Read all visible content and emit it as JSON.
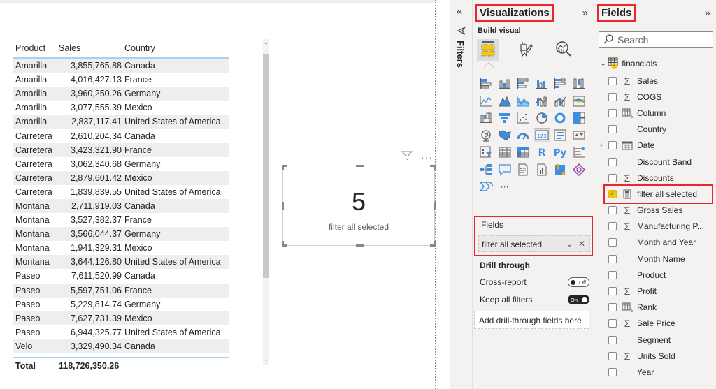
{
  "table": {
    "columns": [
      "Product",
      "Sales",
      "Country"
    ],
    "rows": [
      [
        "Amarilla",
        "3,855,765.88",
        "Canada"
      ],
      [
        "Amarilla",
        "4,016,427.13",
        "France"
      ],
      [
        "Amarilla",
        "3,960,250.26",
        "Germany"
      ],
      [
        "Amarilla",
        "3,077,555.39",
        "Mexico"
      ],
      [
        "Amarilla",
        "2,837,117.41",
        "United States of America"
      ],
      [
        "Carretera",
        "2,610,204.34",
        "Canada"
      ],
      [
        "Carretera",
        "3,423,321.90",
        "France"
      ],
      [
        "Carretera",
        "3,062,340.68",
        "Germany"
      ],
      [
        "Carretera",
        "2,879,601.42",
        "Mexico"
      ],
      [
        "Carretera",
        "1,839,839.55",
        "United States of America"
      ],
      [
        "Montana",
        "2,711,919.03",
        "Canada"
      ],
      [
        "Montana",
        "3,527,382.37",
        "France"
      ],
      [
        "Montana",
        "3,566,044.37",
        "Germany"
      ],
      [
        "Montana",
        "1,941,329.31",
        "Mexico"
      ],
      [
        "Montana",
        "3,644,126.80",
        "United States of America"
      ],
      [
        "Paseo",
        "7,611,520.99",
        "Canada"
      ],
      [
        "Paseo",
        "5,597,751.06",
        "France"
      ],
      [
        "Paseo",
        "5,229,814.74",
        "Germany"
      ],
      [
        "Paseo",
        "7,627,731.39",
        "Mexico"
      ],
      [
        "Paseo",
        "6,944,325.77",
        "United States of America"
      ],
      [
        "Velo",
        "3,329,490.34",
        "Canada"
      ]
    ],
    "total_label": "Total",
    "total_value": "118,726,350.26"
  },
  "card": {
    "value": "5",
    "label": "filter all selected"
  },
  "filters_pane": {
    "label": "Filters"
  },
  "visualizations": {
    "title": "Visualizations",
    "build_visual": "Build visual",
    "more_label": "···",
    "fields_well": {
      "title": "Fields",
      "value": "filter all selected"
    },
    "drill_through": {
      "title": "Drill through",
      "cross_report": {
        "label": "Cross-report",
        "state": "Off"
      },
      "keep_all_filters": {
        "label": "Keep all filters",
        "state": "On"
      },
      "dropzone": "Add drill-through fields here"
    }
  },
  "fields": {
    "title": "Fields",
    "search_placeholder": "Search",
    "table_name": "financials",
    "items": [
      {
        "label": "Sales",
        "icon": "sigma",
        "checked": false
      },
      {
        "label": "COGS",
        "icon": "sigma",
        "checked": false
      },
      {
        "label": "Column",
        "icon": "calc-table",
        "checked": false
      },
      {
        "label": "Country",
        "icon": "",
        "checked": false
      },
      {
        "label": "Date",
        "icon": "calendar",
        "checked": false,
        "expandable": true
      },
      {
        "label": "Discount Band",
        "icon": "",
        "checked": false
      },
      {
        "label": "Discounts",
        "icon": "sigma",
        "checked": false
      },
      {
        "label": "filter all selected",
        "icon": "calculator",
        "checked": true
      },
      {
        "label": "Gross Sales",
        "icon": "sigma",
        "checked": false
      },
      {
        "label": "Manufacturing P...",
        "icon": "sigma",
        "checked": false
      },
      {
        "label": "Month and Year",
        "icon": "",
        "checked": false
      },
      {
        "label": "Month Name",
        "icon": "",
        "checked": false
      },
      {
        "label": "Product",
        "icon": "",
        "checked": false
      },
      {
        "label": "Profit",
        "icon": "sigma",
        "checked": false
      },
      {
        "label": "Rank",
        "icon": "calc-table",
        "checked": false
      },
      {
        "label": "Sale Price",
        "icon": "sigma",
        "checked": false
      },
      {
        "label": "Segment",
        "icon": "",
        "checked": false
      },
      {
        "label": "Units Sold",
        "icon": "sigma",
        "checked": false
      },
      {
        "label": "Year",
        "icon": "",
        "checked": false
      }
    ]
  },
  "colors": {
    "accent_yellow": "#f2c811",
    "highlight_red": "#e8262d",
    "table_rule_blue": "#a9d1f1",
    "viz_blue": "#3a8ee6"
  }
}
